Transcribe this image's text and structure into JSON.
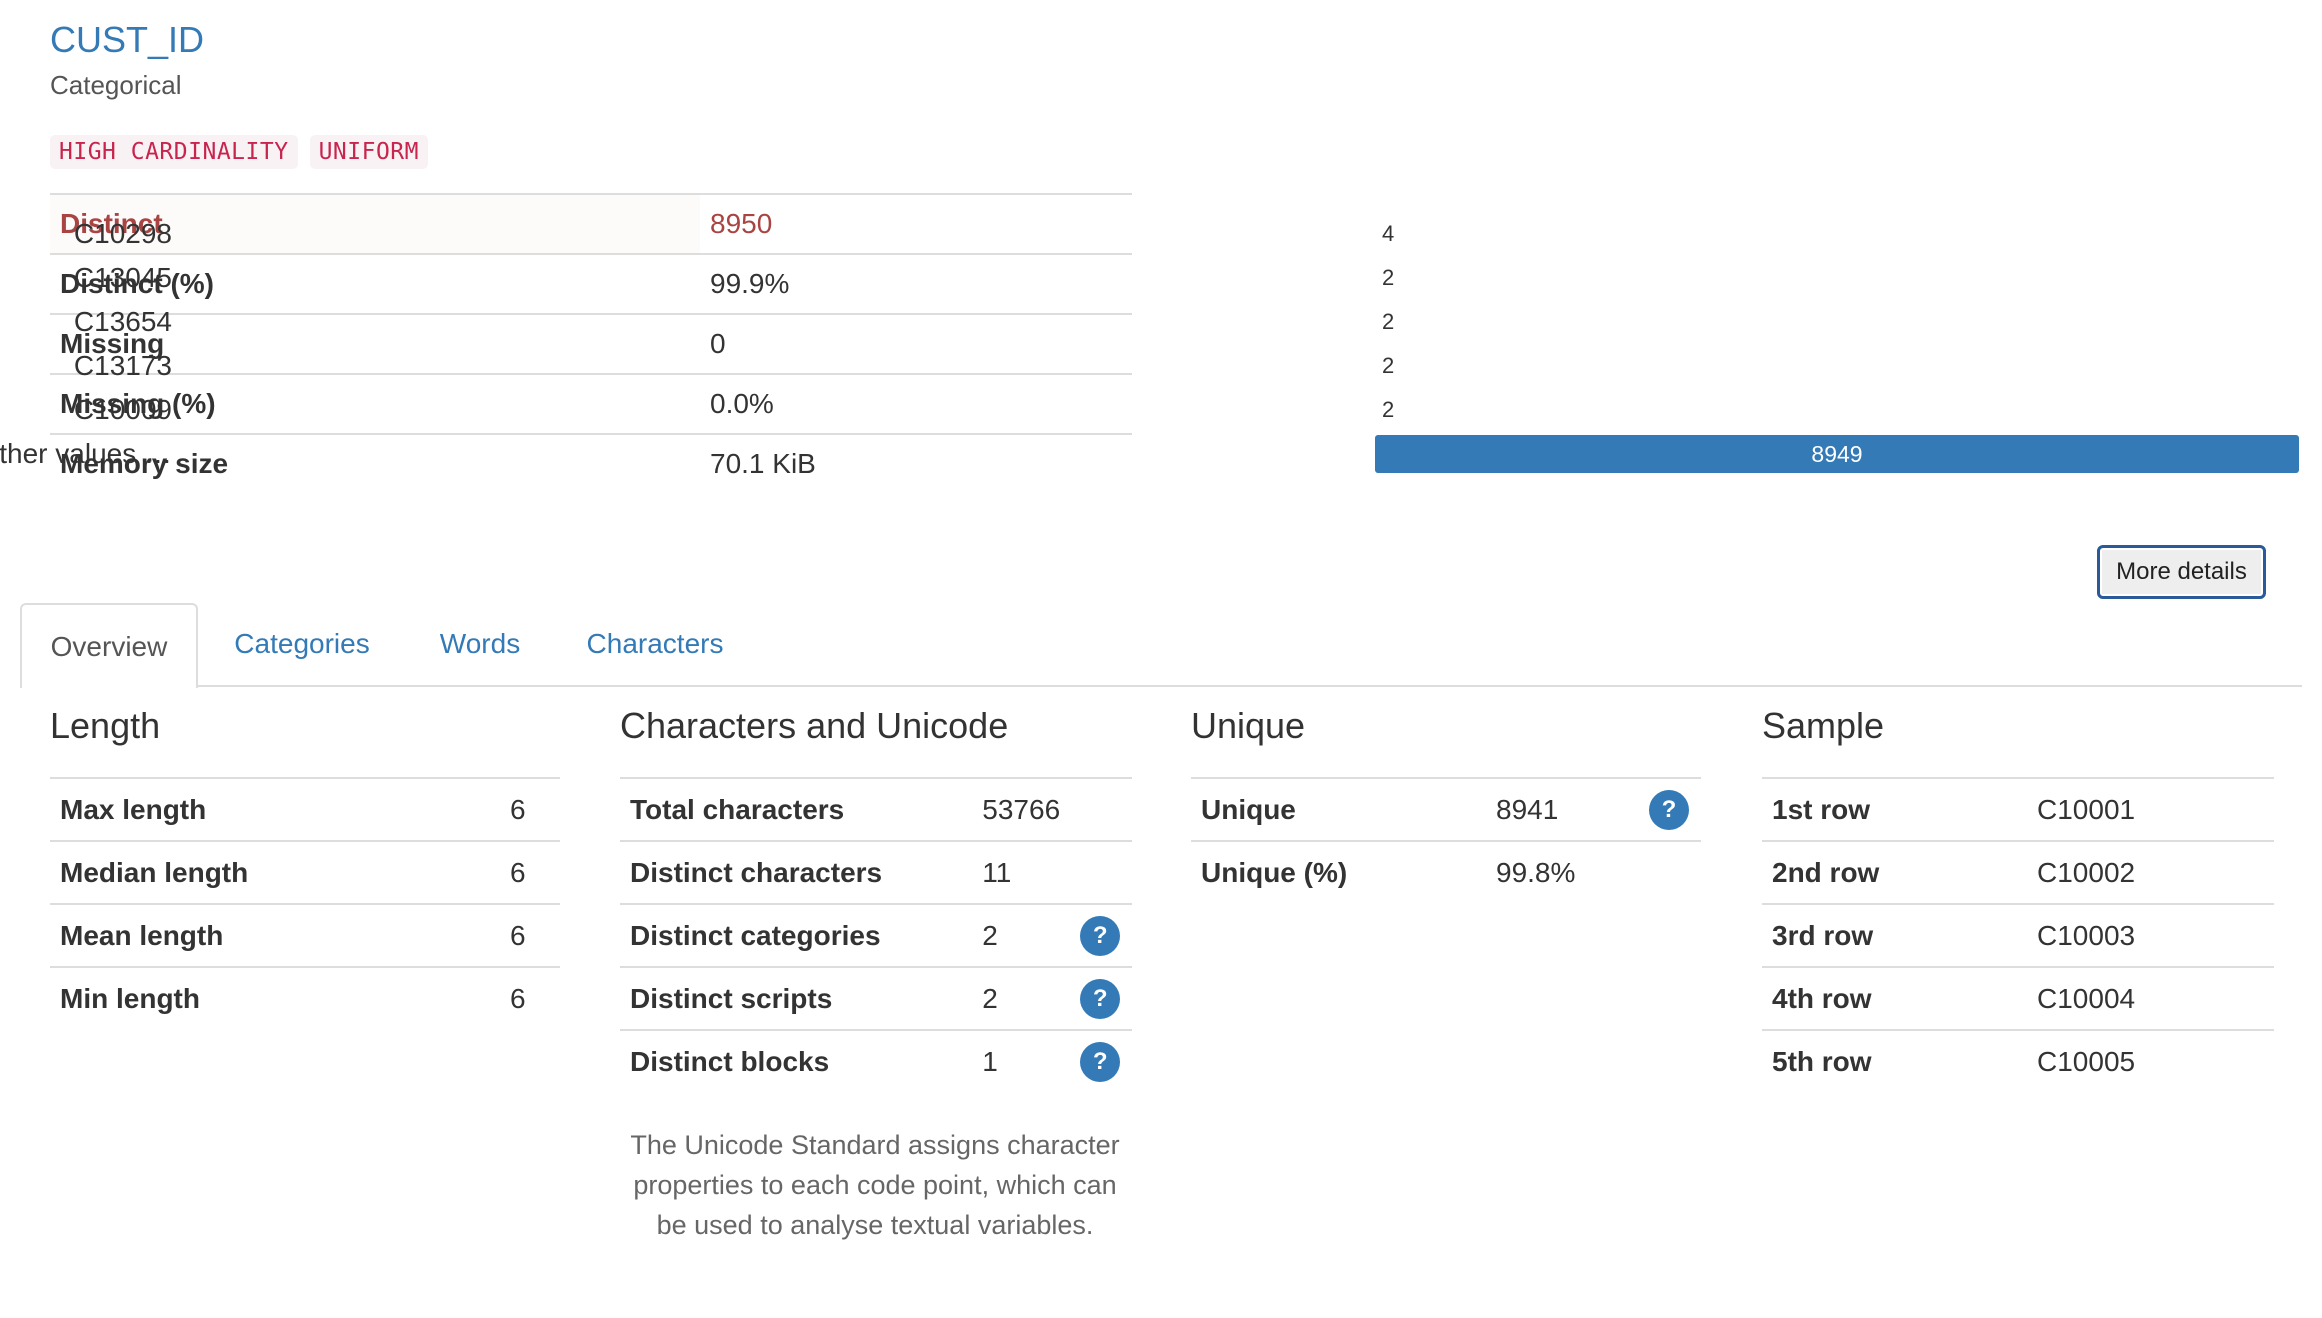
{
  "variable": {
    "name": "CUST_ID",
    "type": "Categorical",
    "badges": [
      "HIGH CARDINALITY",
      "UNIFORM"
    ]
  },
  "stats": [
    {
      "label": "Distinct",
      "value": "8950"
    },
    {
      "label": "Distinct (%)",
      "value": "99.9%"
    },
    {
      "label": "Missing",
      "value": "0"
    },
    {
      "label": "Missing (%)",
      "value": "0.0%"
    },
    {
      "label": "Memory size",
      "value": "70.1 KiB"
    }
  ],
  "frequency": {
    "bar_color": "#337ab7",
    "items": [
      {
        "label": "C10298",
        "count": "4",
        "value": 4
      },
      {
        "label": "C13045",
        "count": "2",
        "value": 2
      },
      {
        "label": "C13654",
        "count": "2",
        "value": 2
      },
      {
        "label": "C13173",
        "count": "2",
        "value": 2
      },
      {
        "label": "C10009",
        "count": "2",
        "value": 2
      },
      {
        "label": "Other values …",
        "count": "8949",
        "value": 8949
      }
    ]
  },
  "more_details_label": "More details",
  "tabs": [
    "Overview",
    "Categories",
    "Words",
    "Characters"
  ],
  "length": {
    "title": "Length",
    "rows": [
      {
        "label": "Max length",
        "value": "6"
      },
      {
        "label": "Median length",
        "value": "6"
      },
      {
        "label": "Mean length",
        "value": "6"
      },
      {
        "label": "Min length",
        "value": "6"
      }
    ]
  },
  "unicode": {
    "title": "Characters and Unicode",
    "rows": [
      {
        "label": "Total characters",
        "value": "53766"
      },
      {
        "label": "Distinct characters",
        "value": "11"
      },
      {
        "label": "Distinct categories",
        "value": "2",
        "help": "?"
      },
      {
        "label": "Distinct scripts",
        "value": "2",
        "help": "?"
      },
      {
        "label": "Distinct blocks",
        "value": "1",
        "help": "?"
      }
    ],
    "note": "The Unicode Standard assigns character properties to each code point, which can be used to analyse textual variables."
  },
  "unique": {
    "title": "Unique",
    "rows": [
      {
        "label": "Unique",
        "value": "8941",
        "help": "?"
      },
      {
        "label": "Unique (%)",
        "value": "99.8%"
      }
    ]
  },
  "sample": {
    "title": "Sample",
    "rows": [
      {
        "label": "1st row",
        "value": "C10001"
      },
      {
        "label": "2nd row",
        "value": "C10002"
      },
      {
        "label": "3rd row",
        "value": "C10003"
      },
      {
        "label": "4th row",
        "value": "C10004"
      },
      {
        "label": "5th row",
        "value": "C10005"
      }
    ]
  }
}
